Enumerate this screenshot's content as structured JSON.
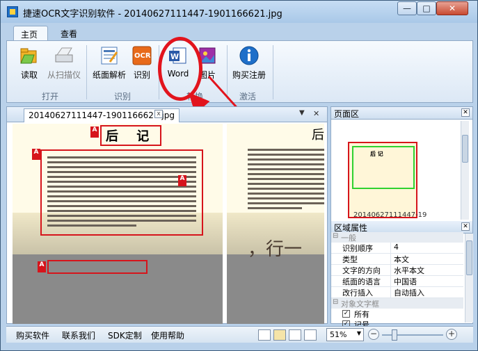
{
  "window": {
    "title": "捷速OCR文字识别软件 - 20140627111447-1901166621.jpg",
    "minimize_glyph": "—",
    "maximize_glyph": "□",
    "close_glyph": "✕"
  },
  "menu": {
    "tabs": [
      {
        "label": "主页"
      },
      {
        "label": "查看"
      }
    ]
  },
  "ribbon": {
    "groups": [
      {
        "label": "打开"
      },
      {
        "label": "识别"
      },
      {
        "label": "转换"
      },
      {
        "label": "激活"
      }
    ],
    "buttons": {
      "read": "读取",
      "scan": "从扫描仪",
      "layout": "纸面解析",
      "recognize": "识别",
      "word": "Word",
      "image": "图片",
      "register": "购买注册"
    },
    "icons": {
      "read": "folder-open-icon",
      "scan": "scanner-icon",
      "layout": "page-layout-icon",
      "recognize": "ocr-icon",
      "word": "word-doc-icon",
      "image": "image-icon",
      "register": "info-icon"
    }
  },
  "document": {
    "tab_label": "20140627111447-1901166621.jpg",
    "tab_close": "x",
    "dropdown_arrow": "▼",
    "panel_close": "✕",
    "page_heading": "后 记",
    "right_heading": "后",
    "right_big": "，行一",
    "area_tag": "A"
  },
  "page_panel": {
    "title": "页面区",
    "thumb_title": "后 记",
    "thumb_label": "20140627111447-19"
  },
  "properties": {
    "title": "区域属性",
    "sections": {
      "general": "一般",
      "text_obj": "对象文字框"
    },
    "rows": [
      {
        "name": "识别顺序",
        "value": "4"
      },
      {
        "name": "类型",
        "value": "本文"
      },
      {
        "name": "文字的方向",
        "value": "水平本文"
      },
      {
        "name": "纸面的语言",
        "value": "中国语"
      },
      {
        "name": "改行插入",
        "value": "自动插入"
      }
    ],
    "checkboxes": [
      {
        "label": "所有",
        "checked": true
      },
      {
        "label": "记号",
        "checked": true
      }
    ]
  },
  "statusbar": {
    "links": [
      "购买软件",
      "联系我们",
      "SDK定制",
      "使用帮助"
    ],
    "zoom": "51%",
    "zoom_out": "−",
    "zoom_in": "+",
    "zoom_level": 0.51
  },
  "colors": {
    "accent_red": "#d6141b",
    "highlight_green": "#2fd12f",
    "titlebar": "#b9d1ea"
  }
}
